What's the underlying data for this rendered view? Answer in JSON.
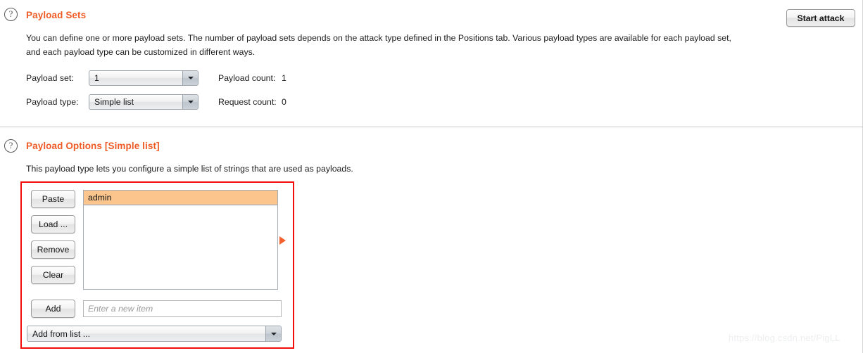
{
  "window": {
    "background_color": "#ffffff",
    "accent_color": "#ef5b25",
    "annotation_color": "#f20d0d",
    "selection_color": "#fbc58d"
  },
  "toolbar": {
    "start_attack_label": "Start attack"
  },
  "payload_sets": {
    "help_icon": "question-mark-icon",
    "title": "Payload Sets",
    "description_line1": "You can define one or more payload sets. The number of payload sets depends on the attack type defined in the Positions tab. Various payload types are available for each payload set,",
    "description_line2": "and each payload type can be customized in different ways.",
    "payload_set_label": "Payload set:",
    "payload_set_value": "1",
    "payload_type_label": "Payload type:",
    "payload_type_value": "Simple list",
    "payload_count_label": "Payload count:",
    "payload_count_value": "1",
    "request_count_label": "Request count:",
    "request_count_value": "0"
  },
  "payload_options": {
    "help_icon": "question-mark-icon",
    "title": "Payload Options [Simple list]",
    "description": "This payload type lets you configure a simple list of strings that are used as payloads.",
    "buttons": {
      "paste": "Paste",
      "load": "Load ...",
      "remove": "Remove",
      "clear": "Clear",
      "add": "Add"
    },
    "list_items": [
      {
        "value": "admin",
        "selected": true
      }
    ],
    "new_item_placeholder": "Enter a new item",
    "new_item_value": "",
    "add_from_list_value": "Add from list ...",
    "marker_icon": "play-triangle-icon"
  },
  "watermark": {
    "text": "https://blog.csdn.net/PigLL"
  }
}
